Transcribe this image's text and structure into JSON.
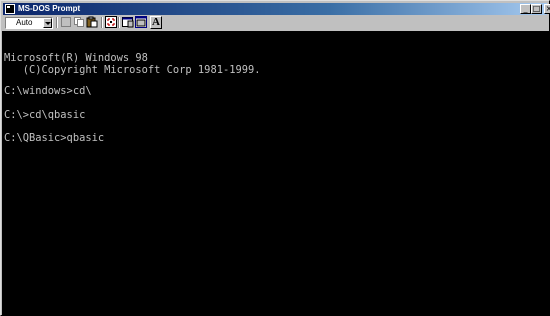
{
  "window": {
    "title": "MS-DOS Prompt"
  },
  "title_buttons": {
    "minimize": "_",
    "maximize": "□",
    "close": "×"
  },
  "toolbar": {
    "font_size_value": "Auto",
    "bold_font_label": "A"
  },
  "icons": {
    "app": "ms-dos-icon",
    "mark": "mark-icon",
    "copy": "copy-icon",
    "paste": "paste-icon",
    "fullscreen": "fullscreen-icon",
    "properties": "properties-icon",
    "background": "background-icon",
    "font": "font-icon"
  },
  "colors": {
    "titlebar_start": "#0a246a",
    "titlebar_end": "#a6caf0",
    "console_bg": "#000000",
    "console_text": "#c0c0c0"
  },
  "console": {
    "lines": [
      "",
      "Microsoft(R) Windows 98",
      "   (C)Copyright Microsoft Corp 1981-1999.",
      "",
      "C:\\windows>cd\\",
      "",
      "C:\\>cd\\qbasic",
      "",
      "C:\\QBasic>qbasic"
    ]
  }
}
